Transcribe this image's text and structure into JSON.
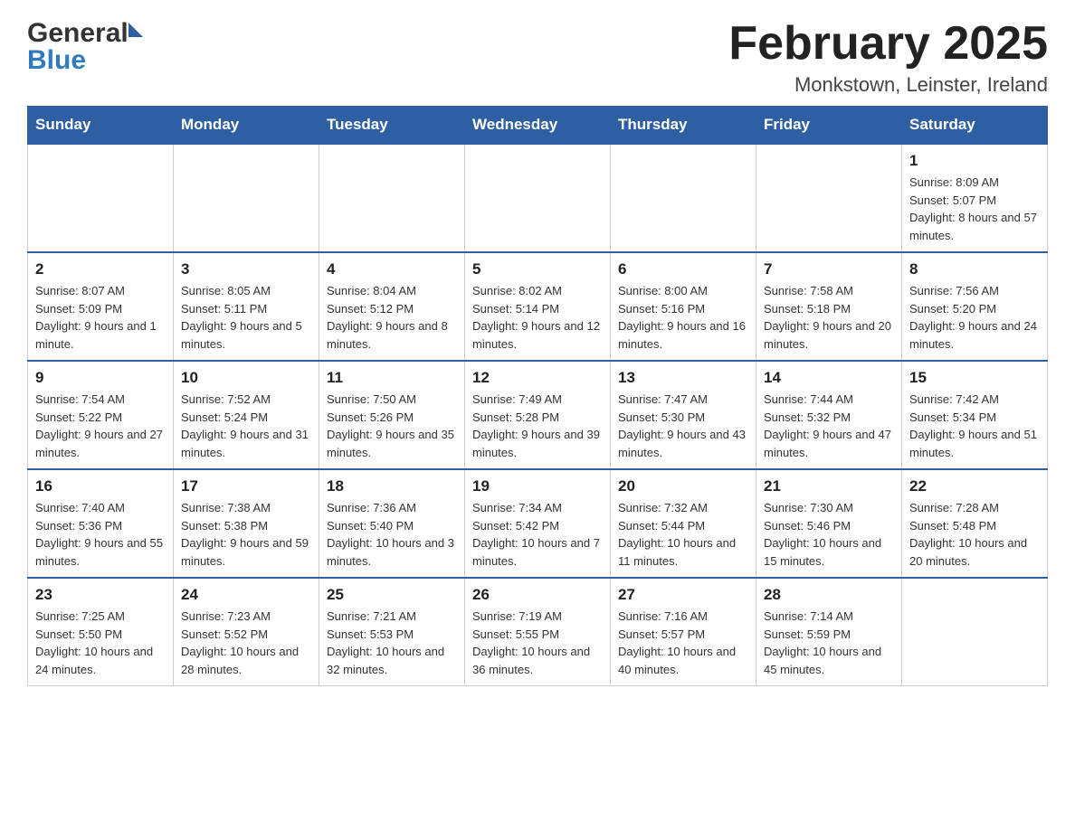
{
  "header": {
    "logo_general": "General",
    "logo_blue": "Blue",
    "month_title": "February 2025",
    "location": "Monkstown, Leinster, Ireland"
  },
  "days_of_week": [
    "Sunday",
    "Monday",
    "Tuesday",
    "Wednesday",
    "Thursday",
    "Friday",
    "Saturday"
  ],
  "weeks": [
    [
      {
        "day": "",
        "sunrise": "",
        "sunset": "",
        "daylight": ""
      },
      {
        "day": "",
        "sunrise": "",
        "sunset": "",
        "daylight": ""
      },
      {
        "day": "",
        "sunrise": "",
        "sunset": "",
        "daylight": ""
      },
      {
        "day": "",
        "sunrise": "",
        "sunset": "",
        "daylight": ""
      },
      {
        "day": "",
        "sunrise": "",
        "sunset": "",
        "daylight": ""
      },
      {
        "day": "",
        "sunrise": "",
        "sunset": "",
        "daylight": ""
      },
      {
        "day": "1",
        "sunrise": "Sunrise: 8:09 AM",
        "sunset": "Sunset: 5:07 PM",
        "daylight": "Daylight: 8 hours and 57 minutes."
      }
    ],
    [
      {
        "day": "2",
        "sunrise": "Sunrise: 8:07 AM",
        "sunset": "Sunset: 5:09 PM",
        "daylight": "Daylight: 9 hours and 1 minute."
      },
      {
        "day": "3",
        "sunrise": "Sunrise: 8:05 AM",
        "sunset": "Sunset: 5:11 PM",
        "daylight": "Daylight: 9 hours and 5 minutes."
      },
      {
        "day": "4",
        "sunrise": "Sunrise: 8:04 AM",
        "sunset": "Sunset: 5:12 PM",
        "daylight": "Daylight: 9 hours and 8 minutes."
      },
      {
        "day": "5",
        "sunrise": "Sunrise: 8:02 AM",
        "sunset": "Sunset: 5:14 PM",
        "daylight": "Daylight: 9 hours and 12 minutes."
      },
      {
        "day": "6",
        "sunrise": "Sunrise: 8:00 AM",
        "sunset": "Sunset: 5:16 PM",
        "daylight": "Daylight: 9 hours and 16 minutes."
      },
      {
        "day": "7",
        "sunrise": "Sunrise: 7:58 AM",
        "sunset": "Sunset: 5:18 PM",
        "daylight": "Daylight: 9 hours and 20 minutes."
      },
      {
        "day": "8",
        "sunrise": "Sunrise: 7:56 AM",
        "sunset": "Sunset: 5:20 PM",
        "daylight": "Daylight: 9 hours and 24 minutes."
      }
    ],
    [
      {
        "day": "9",
        "sunrise": "Sunrise: 7:54 AM",
        "sunset": "Sunset: 5:22 PM",
        "daylight": "Daylight: 9 hours and 27 minutes."
      },
      {
        "day": "10",
        "sunrise": "Sunrise: 7:52 AM",
        "sunset": "Sunset: 5:24 PM",
        "daylight": "Daylight: 9 hours and 31 minutes."
      },
      {
        "day": "11",
        "sunrise": "Sunrise: 7:50 AM",
        "sunset": "Sunset: 5:26 PM",
        "daylight": "Daylight: 9 hours and 35 minutes."
      },
      {
        "day": "12",
        "sunrise": "Sunrise: 7:49 AM",
        "sunset": "Sunset: 5:28 PM",
        "daylight": "Daylight: 9 hours and 39 minutes."
      },
      {
        "day": "13",
        "sunrise": "Sunrise: 7:47 AM",
        "sunset": "Sunset: 5:30 PM",
        "daylight": "Daylight: 9 hours and 43 minutes."
      },
      {
        "day": "14",
        "sunrise": "Sunrise: 7:44 AM",
        "sunset": "Sunset: 5:32 PM",
        "daylight": "Daylight: 9 hours and 47 minutes."
      },
      {
        "day": "15",
        "sunrise": "Sunrise: 7:42 AM",
        "sunset": "Sunset: 5:34 PM",
        "daylight": "Daylight: 9 hours and 51 minutes."
      }
    ],
    [
      {
        "day": "16",
        "sunrise": "Sunrise: 7:40 AM",
        "sunset": "Sunset: 5:36 PM",
        "daylight": "Daylight: 9 hours and 55 minutes."
      },
      {
        "day": "17",
        "sunrise": "Sunrise: 7:38 AM",
        "sunset": "Sunset: 5:38 PM",
        "daylight": "Daylight: 9 hours and 59 minutes."
      },
      {
        "day": "18",
        "sunrise": "Sunrise: 7:36 AM",
        "sunset": "Sunset: 5:40 PM",
        "daylight": "Daylight: 10 hours and 3 minutes."
      },
      {
        "day": "19",
        "sunrise": "Sunrise: 7:34 AM",
        "sunset": "Sunset: 5:42 PM",
        "daylight": "Daylight: 10 hours and 7 minutes."
      },
      {
        "day": "20",
        "sunrise": "Sunrise: 7:32 AM",
        "sunset": "Sunset: 5:44 PM",
        "daylight": "Daylight: 10 hours and 11 minutes."
      },
      {
        "day": "21",
        "sunrise": "Sunrise: 7:30 AM",
        "sunset": "Sunset: 5:46 PM",
        "daylight": "Daylight: 10 hours and 15 minutes."
      },
      {
        "day": "22",
        "sunrise": "Sunrise: 7:28 AM",
        "sunset": "Sunset: 5:48 PM",
        "daylight": "Daylight: 10 hours and 20 minutes."
      }
    ],
    [
      {
        "day": "23",
        "sunrise": "Sunrise: 7:25 AM",
        "sunset": "Sunset: 5:50 PM",
        "daylight": "Daylight: 10 hours and 24 minutes."
      },
      {
        "day": "24",
        "sunrise": "Sunrise: 7:23 AM",
        "sunset": "Sunset: 5:52 PM",
        "daylight": "Daylight: 10 hours and 28 minutes."
      },
      {
        "day": "25",
        "sunrise": "Sunrise: 7:21 AM",
        "sunset": "Sunset: 5:53 PM",
        "daylight": "Daylight: 10 hours and 32 minutes."
      },
      {
        "day": "26",
        "sunrise": "Sunrise: 7:19 AM",
        "sunset": "Sunset: 5:55 PM",
        "daylight": "Daylight: 10 hours and 36 minutes."
      },
      {
        "day": "27",
        "sunrise": "Sunrise: 7:16 AM",
        "sunset": "Sunset: 5:57 PM",
        "daylight": "Daylight: 10 hours and 40 minutes."
      },
      {
        "day": "28",
        "sunrise": "Sunrise: 7:14 AM",
        "sunset": "Sunset: 5:59 PM",
        "daylight": "Daylight: 10 hours and 45 minutes."
      },
      {
        "day": "",
        "sunrise": "",
        "sunset": "",
        "daylight": ""
      }
    ]
  ]
}
